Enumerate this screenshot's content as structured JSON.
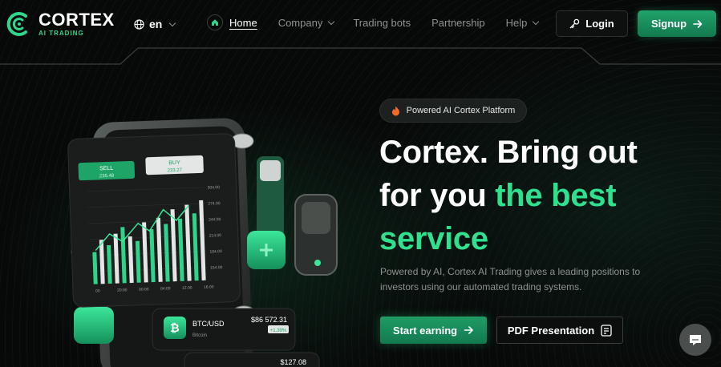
{
  "brand": {
    "name": "CORTEX",
    "tagline": "AI TRADING",
    "accent_color": "#2fe08f"
  },
  "language": {
    "current": "en"
  },
  "nav": {
    "home": "Home",
    "company": "Company",
    "trading_bots": "Trading bots",
    "partnership": "Partnership",
    "help": "Help"
  },
  "auth": {
    "login": "Login",
    "signup": "Signup"
  },
  "hero": {
    "badge": "Powered AI Cortex Platform",
    "title_line1": "Cortex. Bring out",
    "title_line2_plain": "for you ",
    "title_line2_accent": "the best",
    "title_line3_accent": "service",
    "description": "Powered by AI, Cortex AI Trading gives a leading positions to investors using our automated trading systems.",
    "cta_primary": "Start earning",
    "cta_secondary": "PDF Presentation"
  },
  "illustration": {
    "sell_label": "SELL",
    "sell_value": "235.48",
    "buy_label": "BUY",
    "buy_value": "233.27",
    "y_ticks": [
      "304.00",
      "274.00",
      "244.00",
      "214.00",
      "184.00",
      "154.00"
    ],
    "x_ticks": [
      "00",
      "20:00",
      "00:00",
      "04:00",
      "12:00",
      "16:00"
    ],
    "ticker_pair": "BTC/USD",
    "ticker_name": "Bitcoin",
    "ticker_price": "$86 572.31",
    "ticker_change": "+1.39%",
    "ticker2_price": "$127.08"
  }
}
